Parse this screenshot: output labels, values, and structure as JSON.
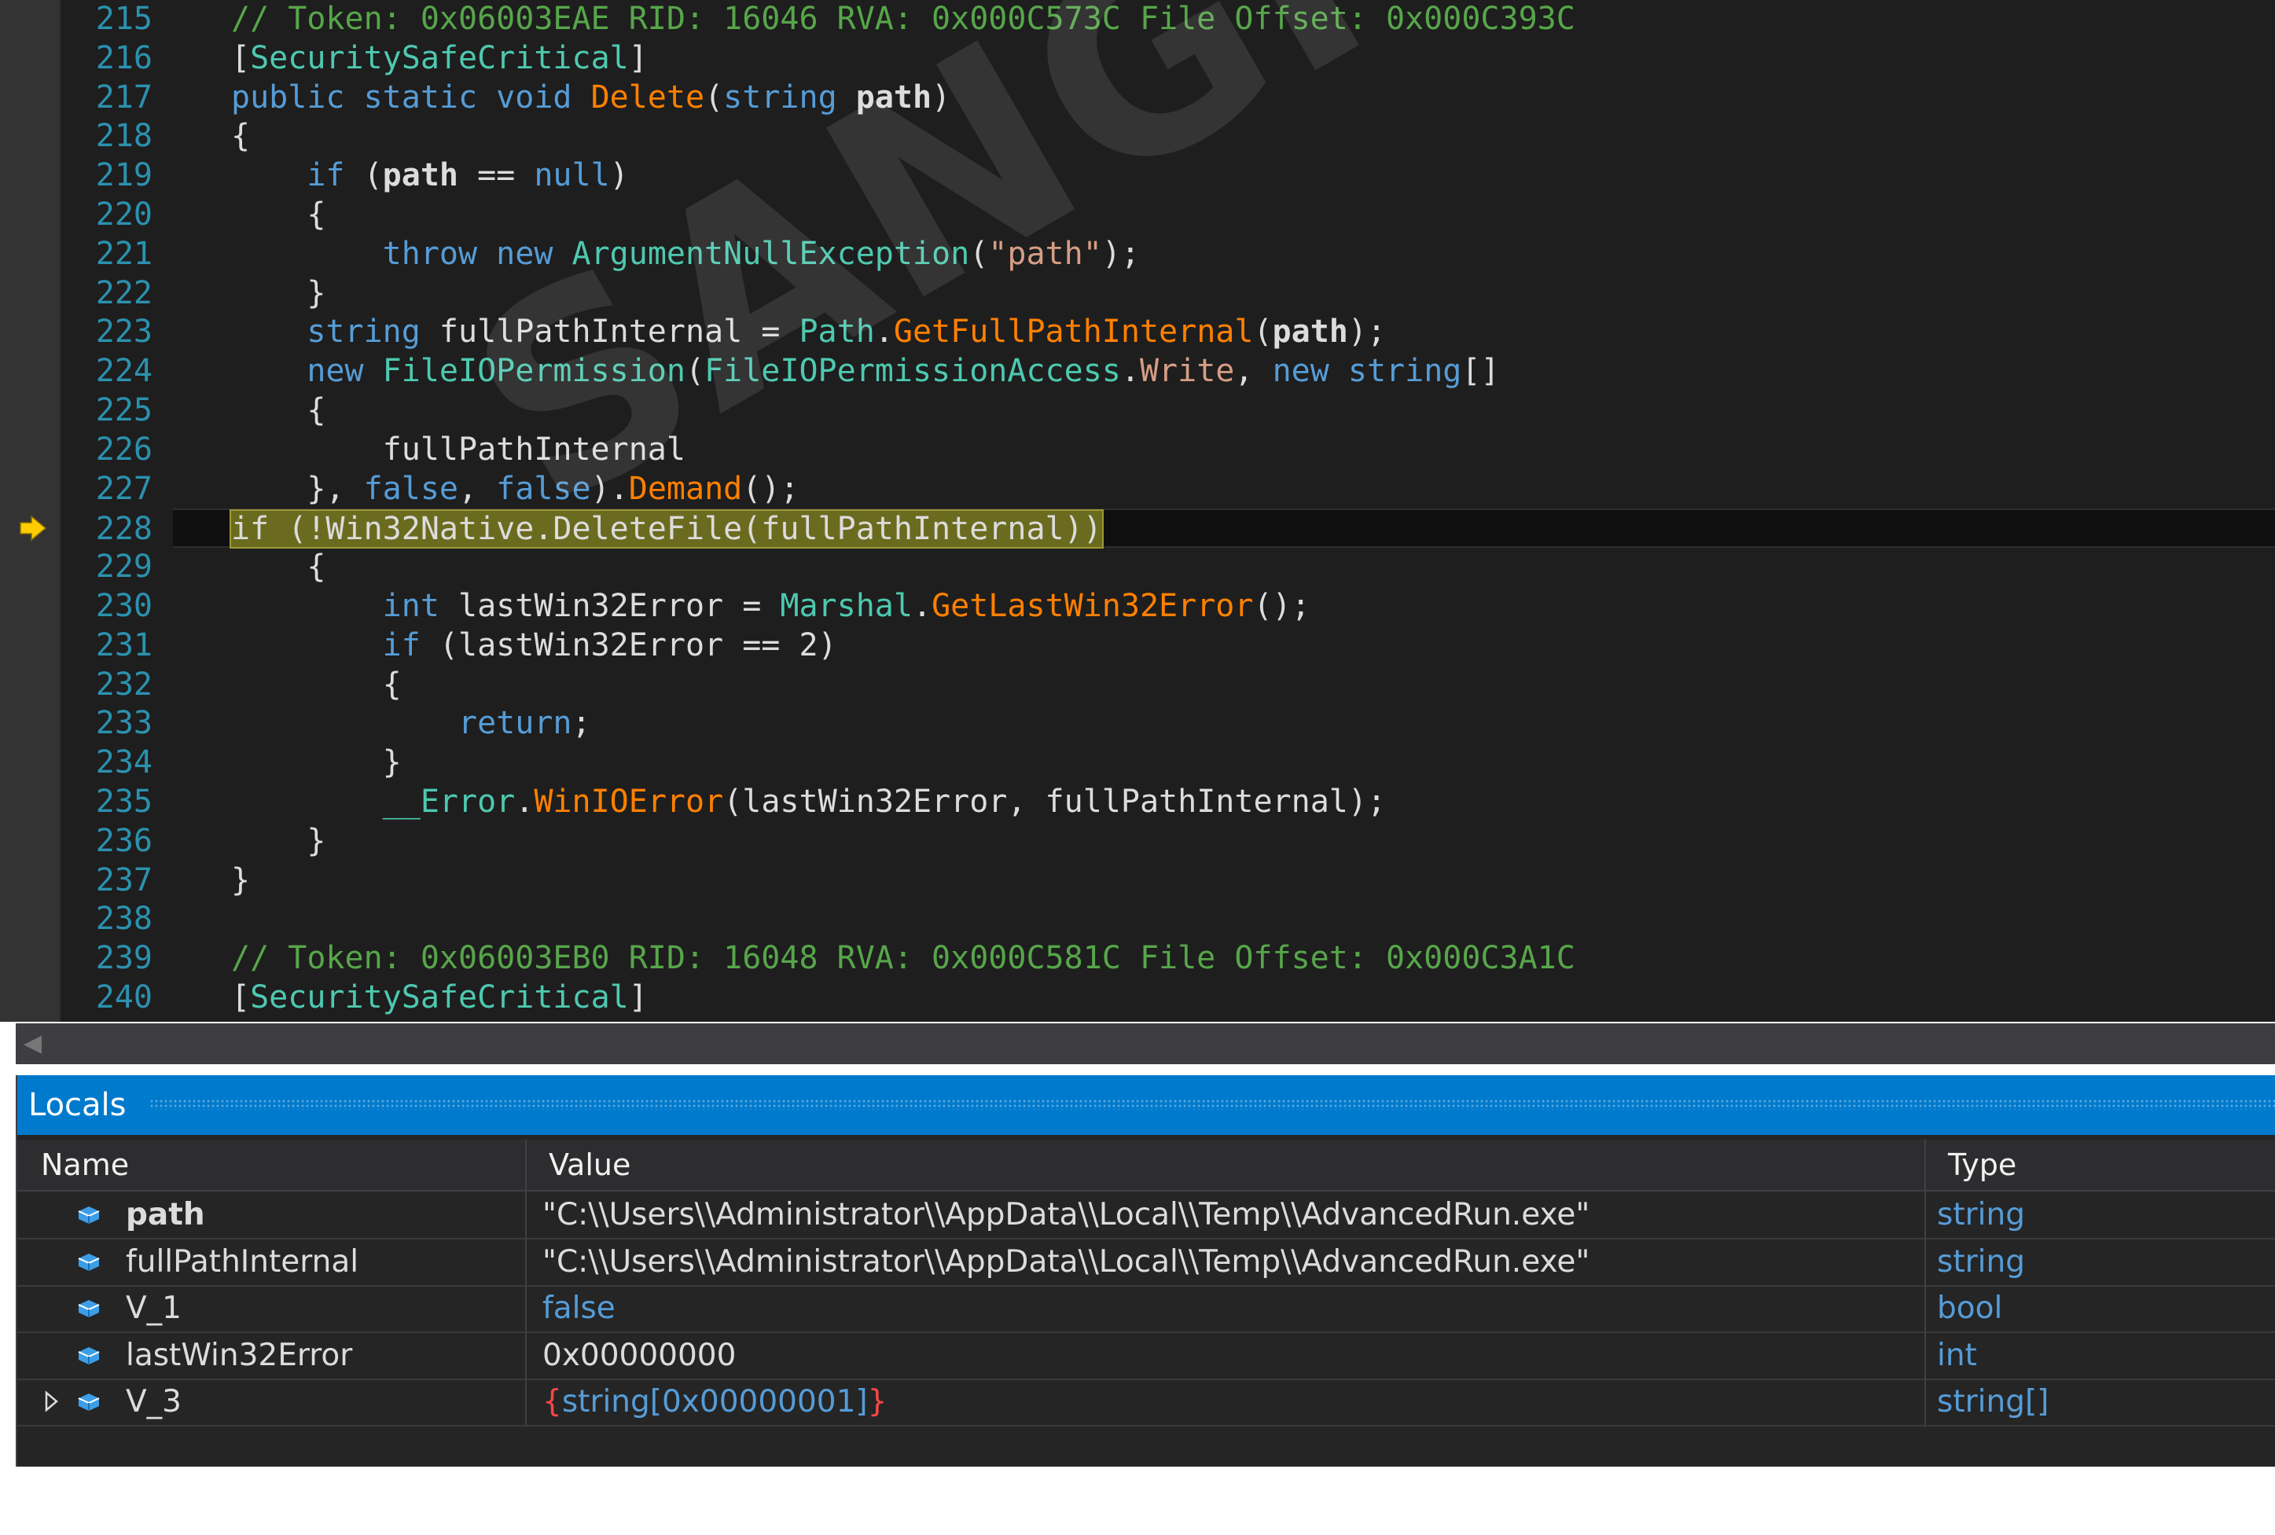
{
  "editor": {
    "lines": [
      {
        "n": "215",
        "segs": [
          [
            "cm",
            "// Token: 0x06003EAE RID: 16046 RVA: 0x000C573C File Offset: 0x000C393C"
          ]
        ]
      },
      {
        "n": "216",
        "segs": [
          [
            "",
            "["
          ],
          [
            "ty",
            "SecuritySafeCritical"
          ],
          [
            "",
            "]"
          ]
        ]
      },
      {
        "n": "217",
        "segs": [
          [
            "kw",
            "public static void "
          ],
          [
            "mt",
            "Delete"
          ],
          [
            "",
            "("
          ],
          [
            "kw",
            "string "
          ],
          [
            "bd",
            "path"
          ],
          [
            "",
            ")"
          ]
        ]
      },
      {
        "n": "218",
        "segs": [
          [
            "",
            "{"
          ]
        ]
      },
      {
        "n": "219",
        "segs": [
          [
            "",
            "    "
          ],
          [
            "kw",
            "if"
          ],
          [
            "",
            " ("
          ],
          [
            "bd",
            "path"
          ],
          [
            "",
            " == "
          ],
          [
            "kw",
            "null"
          ],
          [
            "",
            ")"
          ]
        ]
      },
      {
        "n": "220",
        "segs": [
          [
            "",
            "    {"
          ]
        ]
      },
      {
        "n": "221",
        "segs": [
          [
            "",
            "        "
          ],
          [
            "kw",
            "throw new "
          ],
          [
            "ty",
            "ArgumentNullException"
          ],
          [
            "",
            "("
          ],
          [
            "st",
            "\"path\""
          ],
          [
            "",
            ");"
          ]
        ]
      },
      {
        "n": "222",
        "segs": [
          [
            "",
            "    }"
          ]
        ]
      },
      {
        "n": "223",
        "segs": [
          [
            "",
            "    "
          ],
          [
            "kw",
            "string "
          ],
          [
            "",
            "fullPathInternal = "
          ],
          [
            "ty",
            "Path"
          ],
          [
            "",
            "."
          ],
          [
            "mt",
            "GetFullPathInternal"
          ],
          [
            "",
            "("
          ],
          [
            "bd",
            "path"
          ],
          [
            "",
            ");"
          ]
        ]
      },
      {
        "n": "224",
        "segs": [
          [
            "",
            "    "
          ],
          [
            "kw",
            "new "
          ],
          [
            "ty",
            "FileIOPermission"
          ],
          [
            "",
            "("
          ],
          [
            "ty",
            "FileIOPermissionAccess"
          ],
          [
            "",
            "."
          ],
          [
            "pr",
            "Write"
          ],
          [
            "",
            ", "
          ],
          [
            "kw",
            "new string"
          ],
          [
            "",
            "[]"
          ]
        ]
      },
      {
        "n": "225",
        "segs": [
          [
            "",
            "    {"
          ]
        ]
      },
      {
        "n": "226",
        "segs": [
          [
            "",
            "        fullPathInternal"
          ]
        ]
      },
      {
        "n": "227",
        "segs": [
          [
            "",
            "    }, "
          ],
          [
            "kw",
            "false"
          ],
          [
            "",
            ", "
          ],
          [
            "kw",
            "false"
          ],
          [
            "",
            ")."
          ],
          [
            "mt",
            "Demand"
          ],
          [
            "",
            "();"
          ]
        ]
      },
      {
        "n": "228",
        "current": true,
        "segs": [
          [
            "hl",
            "if (!Win32Native.DeleteFile(fullPathInternal))"
          ]
        ]
      },
      {
        "n": "229",
        "segs": [
          [
            "",
            "    {"
          ]
        ]
      },
      {
        "n": "230",
        "segs": [
          [
            "",
            "        "
          ],
          [
            "kw",
            "int "
          ],
          [
            "",
            "lastWin32Error = "
          ],
          [
            "ty",
            "Marshal"
          ],
          [
            "",
            "."
          ],
          [
            "mt",
            "GetLastWin32Error"
          ],
          [
            "",
            "();"
          ]
        ]
      },
      {
        "n": "231",
        "segs": [
          [
            "",
            "        "
          ],
          [
            "kw",
            "if"
          ],
          [
            "",
            " (lastWin32Error == 2)"
          ]
        ]
      },
      {
        "n": "232",
        "segs": [
          [
            "",
            "        {"
          ]
        ]
      },
      {
        "n": "233",
        "segs": [
          [
            "",
            "            "
          ],
          [
            "kw",
            "return"
          ],
          [
            "",
            ";"
          ]
        ]
      },
      {
        "n": "234",
        "segs": [
          [
            "",
            "        }"
          ]
        ]
      },
      {
        "n": "235",
        "segs": [
          [
            "",
            "        "
          ],
          [
            "ty",
            "__Error"
          ],
          [
            "",
            "."
          ],
          [
            "mt",
            "WinIOError"
          ],
          [
            "",
            "(lastWin32Error, fullPathInternal);"
          ]
        ]
      },
      {
        "n": "236",
        "segs": [
          [
            "",
            "    }"
          ]
        ]
      },
      {
        "n": "237",
        "segs": [
          [
            "",
            "}"
          ]
        ]
      },
      {
        "n": "238",
        "segs": []
      },
      {
        "n": "239",
        "segs": [
          [
            "cm",
            "// Token: 0x06003EB0 RID: 16048 RVA: 0x000C581C File Offset: 0x000C3A1C"
          ]
        ]
      },
      {
        "n": "240",
        "segs": [
          [
            "",
            "["
          ],
          [
            "ty",
            "SecuritySafeCritical"
          ],
          [
            "",
            "]"
          ]
        ]
      }
    ],
    "colors": {
      "background": "#1e1e1e",
      "line_number": "#2b91af",
      "comment": "#57a64a",
      "keyword": "#569cd6",
      "type": "#4ec9b0",
      "method": "#ff8000",
      "highlight": "#6b6b1f",
      "breakpoint_arrow": "#ffcc00"
    },
    "current_line_icon": "execution-arrow-icon"
  },
  "locals": {
    "title": "Locals",
    "columns": {
      "name": "Name",
      "value": "Value",
      "type": "Type"
    },
    "rows": [
      {
        "name": "path",
        "value": "\"C:\\\\Users\\\\Administrator\\\\AppData\\\\Local\\\\Temp\\\\AdvancedRun.exe\"",
        "type": "string",
        "bold": true,
        "expandable": false
      },
      {
        "name": "fullPathInternal",
        "value": "\"C:\\\\Users\\\\Administrator\\\\AppData\\\\Local\\\\Temp\\\\AdvancedRun.exe\"",
        "type": "string",
        "bold": false,
        "expandable": false
      },
      {
        "name": "V_1",
        "value": "false",
        "type": "bool",
        "bold": false,
        "expandable": false,
        "value_color": "blue"
      },
      {
        "name": "lastWin32Error",
        "value": "0x00000000",
        "type": "int",
        "bold": false,
        "expandable": false
      },
      {
        "name": "V_3",
        "value_open": "{",
        "value_inner": "string[0x00000001]",
        "value_close": "}",
        "type": "string[]",
        "bold": false,
        "expandable": true
      }
    ],
    "title_color": "#007acc",
    "row_icon": "local-variable-icon"
  },
  "watermark": "SANGFOR"
}
